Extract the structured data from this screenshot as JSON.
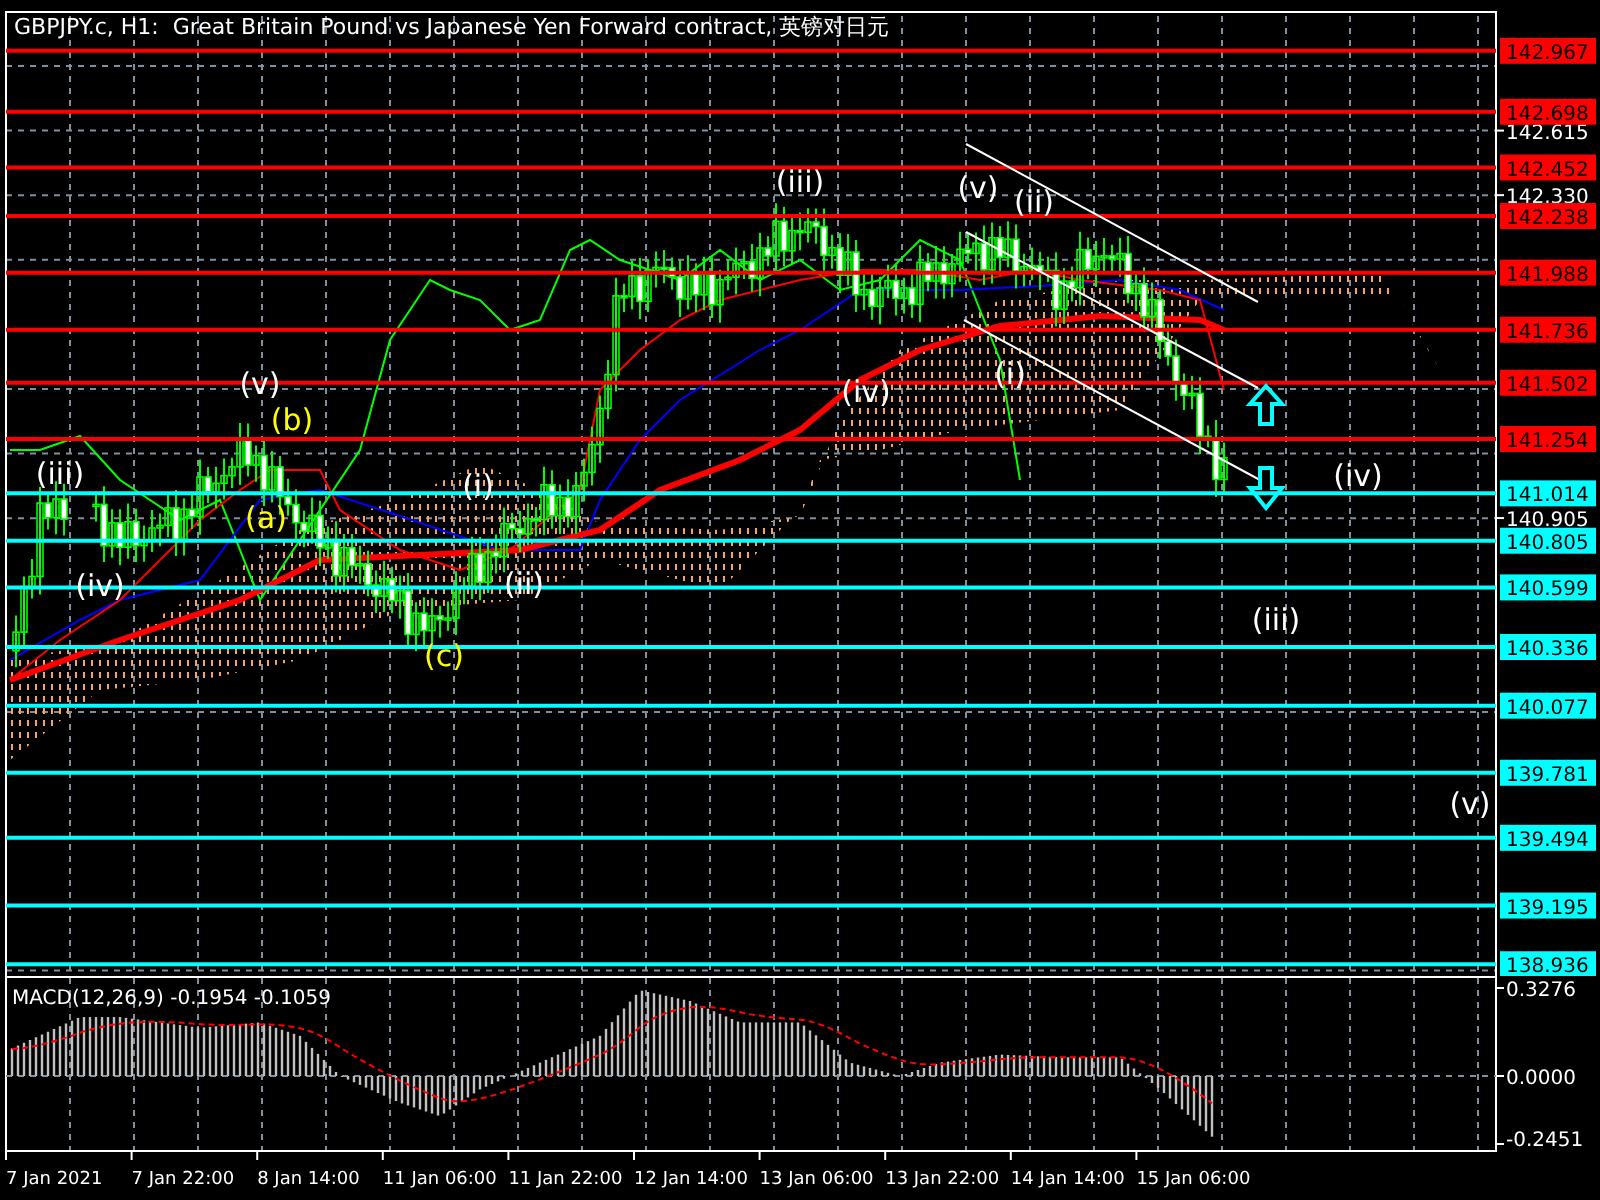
{
  "title": "GBPJPY.c, H1:  Great Britain Pound vs Japanese Yen Forward contract, 英镑对日元",
  "price_axis": [
    "142.615",
    "142.330",
    "140.905"
  ],
  "levels": [
    {
      "kind": "resistance",
      "price": "142.967"
    },
    {
      "kind": "resistance",
      "price": "142.698"
    },
    {
      "kind": "resistance",
      "price": "142.452"
    },
    {
      "kind": "resistance",
      "price": "142.238"
    },
    {
      "kind": "resistance",
      "price": "141.988"
    },
    {
      "kind": "resistance",
      "price": "141.736"
    },
    {
      "kind": "resistance",
      "price": "141.502"
    },
    {
      "kind": "resistance",
      "price": "141.254"
    },
    {
      "kind": "support",
      "price": "141.014"
    },
    {
      "kind": "support",
      "price": "140.805"
    },
    {
      "kind": "support",
      "price": "140.599"
    },
    {
      "kind": "support",
      "price": "140.336"
    },
    {
      "kind": "support",
      "price": "140.077"
    },
    {
      "kind": "support",
      "price": "139.781"
    },
    {
      "kind": "support",
      "price": "139.494"
    },
    {
      "kind": "support",
      "price": "139.195"
    },
    {
      "kind": "support",
      "price": "138.936"
    }
  ],
  "waves": [
    {
      "label": "(iii)",
      "color": "#ffffff"
    },
    {
      "label": "(iv)",
      "color": "#ffffff"
    },
    {
      "label": "(v)",
      "color": "#ffffff"
    },
    {
      "label": "(b)",
      "color": "#ffff00"
    },
    {
      "label": "(a)",
      "color": "#ffff00"
    },
    {
      "label": "(c)",
      "color": "#ffff00"
    },
    {
      "label": "(i)",
      "color": "#ffffff"
    },
    {
      "label": "(ii)",
      "color": "#ffffff"
    },
    {
      "label": "(iii)",
      "color": "#ffffff"
    },
    {
      "label": "(iv)",
      "color": "#ffffff"
    },
    {
      "label": "(v)",
      "color": "#ffffff"
    },
    {
      "label": "(ii)",
      "color": "#ffffff"
    },
    {
      "label": "(i)",
      "color": "#ffffff"
    },
    {
      "label": "(iv)",
      "color": "#ffffff"
    },
    {
      "label": "(iii)",
      "color": "#ffffff"
    },
    {
      "label": "(v)",
      "color": "#ffffff"
    }
  ],
  "macd": {
    "label": "MACD(12,26,9) -0.1954 -0.1059",
    "axis": [
      "0.3276",
      "0.0000",
      "-0.2451"
    ]
  },
  "time_axis": [
    "7 Jan 2021",
    "7 Jan 22:00",
    "8 Jan 14:00",
    "11 Jan 06:00",
    "11 Jan 22:00",
    "12 Jan 14:00",
    "13 Jan 06:00",
    "13 Jan 22:00",
    "14 Jan 14:00",
    "15 Jan 06:00"
  ]
}
